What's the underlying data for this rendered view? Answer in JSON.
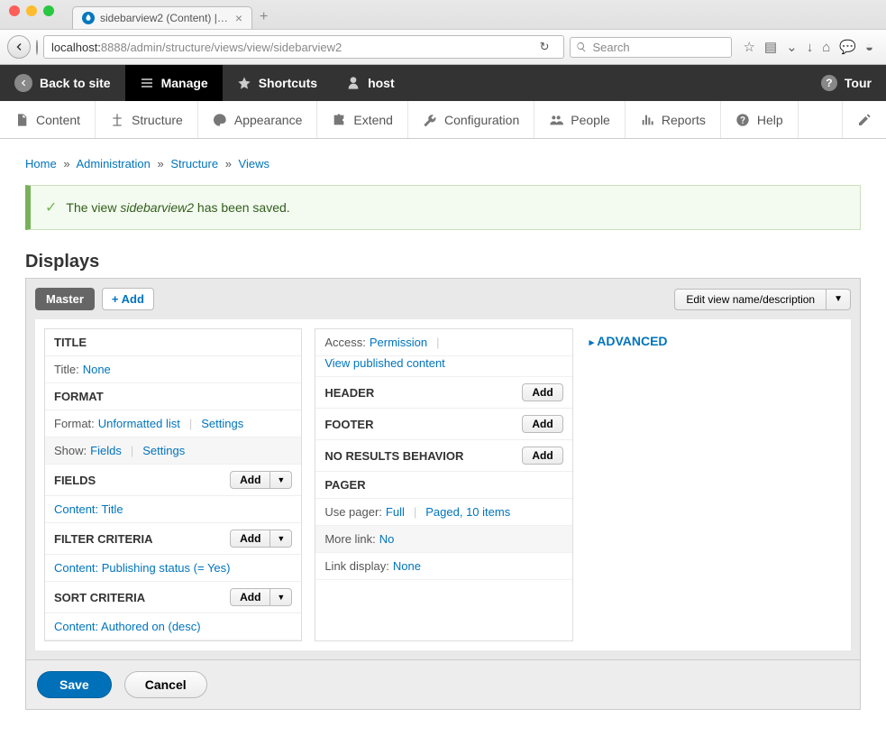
{
  "browser": {
    "tab_title": "sidebarview2 (Content) | H...",
    "url_host": "localhost:",
    "url_port": "8888",
    "url_path": "/admin/structure/views/view/sidebarview2",
    "search_placeholder": "Search"
  },
  "admin_bar": {
    "back": "Back to site",
    "manage": "Manage",
    "shortcuts": "Shortcuts",
    "user": "host",
    "tour": "Tour"
  },
  "subnav": {
    "content": "Content",
    "structure": "Structure",
    "appearance": "Appearance",
    "extend": "Extend",
    "configuration": "Configuration",
    "people": "People",
    "reports": "Reports",
    "help": "Help"
  },
  "breadcrumb": {
    "home": "Home",
    "admin": "Administration",
    "structure": "Structure",
    "views": "Views"
  },
  "status": {
    "prefix": "The view ",
    "name": "sidebarview2",
    "suffix": " has been saved."
  },
  "displays": {
    "heading": "Displays",
    "master": "Master",
    "add": "Add",
    "edit_view": "Edit view name/description"
  },
  "col1": {
    "title_section": "TITLE",
    "title_label": "Title:",
    "title_value": "None",
    "format_section": "FORMAT",
    "format_label": "Format:",
    "format_value": "Unformatted list",
    "show_label": "Show:",
    "show_value": "Fields",
    "settings": "Settings",
    "fields_section": "FIELDS",
    "field_item": "Content: Title",
    "filter_section": "FILTER CRITERIA",
    "filter_item": "Content: Publishing status (= Yes)",
    "sort_section": "SORT CRITERIA",
    "sort_item": "Content: Authored on (desc)",
    "add_btn": "Add"
  },
  "col2": {
    "access_label": "Access:",
    "access_value": "Permission",
    "access_perm": "View published content",
    "header_section": "HEADER",
    "footer_section": "FOOTER",
    "noresults_section": "NO RESULTS BEHAVIOR",
    "pager_section": "PAGER",
    "pager_label": "Use pager:",
    "pager_value": "Full",
    "pager_detail": "Paged, 10 items",
    "more_label": "More link:",
    "more_value": "No",
    "linkdisplay_label": "Link display:",
    "linkdisplay_value": "None",
    "add_btn": "Add"
  },
  "col3": {
    "advanced": "ADVANCED"
  },
  "actions": {
    "save": "Save",
    "cancel": "Cancel"
  }
}
